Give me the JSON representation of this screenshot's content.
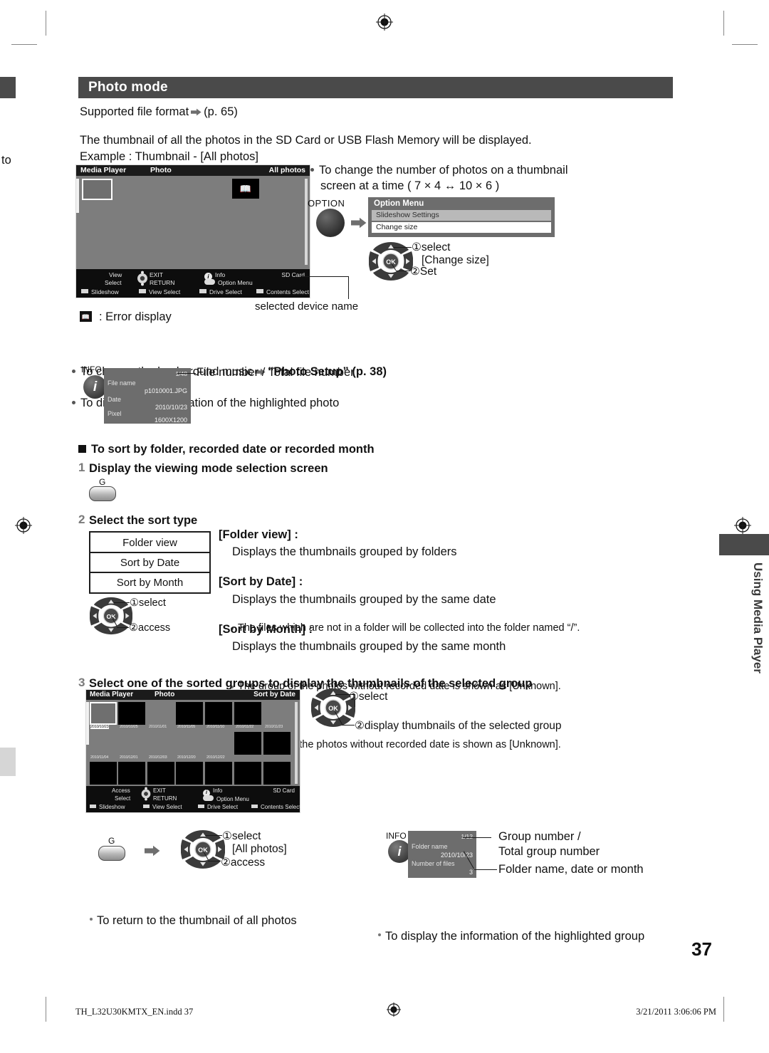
{
  "page": {
    "section_title": "Photo mode",
    "number": "37",
    "left_margin_note": "to",
    "side_tab": "Using Media Player"
  },
  "intro": {
    "supported_format_pre": "Supported file format",
    "supported_format_ref": "(p. 65)",
    "line1": "The thumbnail of all the photos in the SD Card or USB Flash Memory will be displayed.",
    "line2": "Example : Thumbnail - [All photos]"
  },
  "tv_all_photos": {
    "title_left": "Media Player",
    "title_mid": "Photo",
    "title_right": "All photos",
    "guide": {
      "view": "View",
      "select": "Select",
      "exit": "EXIT",
      "return": "RETURN",
      "info": "Info",
      "option_menu": "Option Menu",
      "device": "SD Card",
      "slideshow": "Slideshow",
      "view_select": "View Select",
      "drive_select": "Drive Select",
      "contents_select": "Contents Select"
    }
  },
  "callouts": {
    "selected_device_name": "selected device name",
    "error_display": ": Error display",
    "bg_music_pre": "To change the background music",
    "bg_music_ref": "“Photo Setup” (p. 38)",
    "info_highlighted_photo": "To display the information of the highlighted photo",
    "file_number_label": "File number / Total file number"
  },
  "change_size": {
    "note_line1": "To change the number of photos on a thumbnail",
    "note_line2": "screen at a time ( 7 × 4 ↔ 10 × 6 )",
    "option_button_label": "OPTION",
    "menu_title": "Option Menu",
    "menu_items": [
      "Slideshow Settings",
      "Change size"
    ],
    "step1": "①select",
    "step1b": "[Change size]",
    "step2": "②Set"
  },
  "photo_info": {
    "info_label": "INFO",
    "counter": "1/48",
    "rows": [
      {
        "label": "File name",
        "value": "p1010001.JPG"
      },
      {
        "label": "Date",
        "value": "2010/10/23"
      },
      {
        "label": "Pixel",
        "value": "1600X1200"
      }
    ]
  },
  "sort_section": {
    "heading": "To sort by folder, recorded date or recorded month",
    "step1_num": "1",
    "step1": "Display the viewing mode selection screen",
    "g_button": "G",
    "step2_num": "2",
    "step2": "Select the sort type",
    "options": [
      "Folder view",
      "Sort by Date",
      "Sort by Month"
    ],
    "pad_step1": "①select",
    "pad_step2": "②access",
    "defs": [
      {
        "title": "[Folder view] :",
        "line": "Displays the thumbnails grouped by folders",
        "note": "The files which are not in a folder will be collected into the folder named “/”."
      },
      {
        "title": "[Sort by Date] :",
        "line": "Displays the thumbnails grouped by the same date",
        "note": "The group of the photos without recorded date is shown as [Unknown]."
      },
      {
        "title": "[Sort by Month] :",
        "line": "Displays the thumbnails grouped by the same month",
        "note": "The group of the photos without recorded date is shown as [Unknown]."
      }
    ]
  },
  "step3": {
    "num": "3",
    "text": "Select one of the sorted groups to display the thumbnails of the selected group",
    "pad_step1": "①select",
    "pad_step2": "②display thumbnails of the selected group"
  },
  "tv_sort_by_date": {
    "title_left": "Media Player",
    "title_mid": "Photo",
    "title_right": "Sort by Date",
    "dates_row1": [
      "2010/10/23",
      "2010/10/25",
      "2010/11/01",
      "2010/11/05",
      "2010/11/10",
      "2010/11/22",
      "2010/11/23"
    ],
    "dates_row2": [
      "2010/11/04",
      "2010/12/01",
      "2010/12/03",
      "2010/12/20",
      "2010/12/22"
    ],
    "guide": {
      "access": "Access",
      "select": "Select",
      "exit": "EXIT",
      "return": "RETURN",
      "info": "Info",
      "option_menu": "Option Menu",
      "device": "SD Card",
      "slideshow": "Slideshow",
      "view_select": "View Select",
      "drive_select": "Drive Select",
      "contents_select": "Contents Select"
    }
  },
  "return_all": {
    "text": "To return to the thumbnail of all photos",
    "g_button": "G",
    "step1": "①select",
    "step1b": "[All photos]",
    "step2": "②access"
  },
  "group_info": {
    "text": "To display the information of the highlighted group",
    "info_label": "INFO",
    "counter": "1/12",
    "rows": [
      {
        "label": "Folder name",
        "value": "2010/10/23"
      },
      {
        "label": "Number of files",
        "value": "3"
      }
    ],
    "callout1_l1": "Group number /",
    "callout1_l2": "Total group number",
    "callout2": "Folder name, date or month"
  },
  "footer": {
    "file": "TH_L32U30KMTX_EN.indd   37",
    "timestamp": "3/21/2011   3:06:06 PM"
  }
}
